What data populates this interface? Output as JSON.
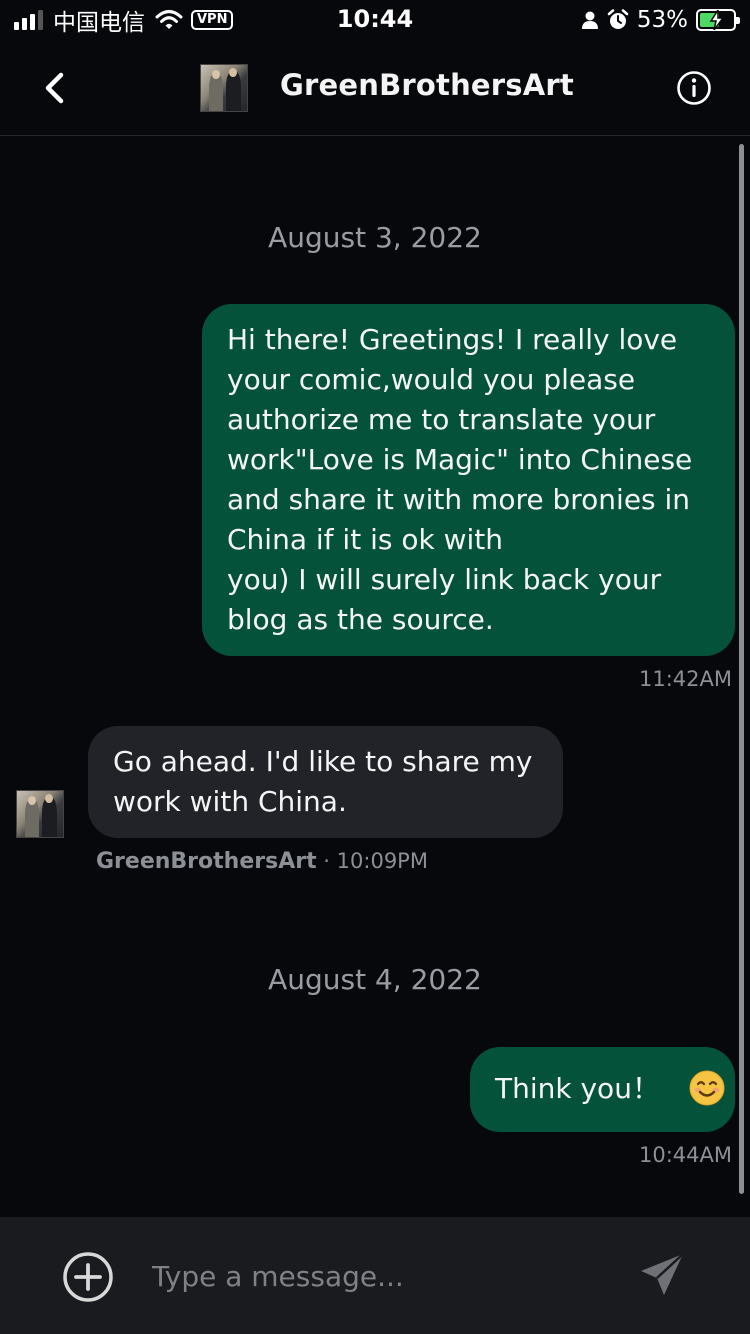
{
  "status_bar": {
    "carrier": "中国电信",
    "vpn_label": "VPN",
    "time": "10:44",
    "battery_percent": "53%",
    "battery_level": 0.53,
    "signal_bars_active": 3,
    "signal_bars_total": 4
  },
  "header": {
    "title": "GreenBrothersArt",
    "back_icon": "chevron-left-icon",
    "info_icon": "info-circle-icon"
  },
  "chat": {
    "date_1": "August 3, 2022",
    "msg_1": {
      "lines": [
        "Hi there! Greetings! I really love",
        "your comic,would you please",
        "authorize me to translate your",
        "work\"Love is Magic\" into Chinese",
        "and share it with more bronies in",
        "China if it is ok with",
        "you) I will surely link back your",
        "blog as the source."
      ],
      "time": "11:42AM"
    },
    "msg_2": {
      "lines": [
        "Go ahead. I'd like to share my",
        "work with China."
      ],
      "sender": "GreenBrothersArt",
      "separator": "·",
      "time": "10:09PM"
    },
    "date_2": "August 4, 2022",
    "msg_3": {
      "text": "Think you！",
      "emoji": "smiling-face-emoji",
      "time": "10:44AM"
    }
  },
  "composer": {
    "placeholder": "Type a message...",
    "add_icon": "plus-circle-icon",
    "send_icon": "send-icon"
  },
  "colors": {
    "background": "#07080c",
    "outgoing_bubble": "#05523a",
    "incoming_bubble": "#212328",
    "composer_bg": "#1a1b1f",
    "muted_text": "#8d8f96"
  }
}
